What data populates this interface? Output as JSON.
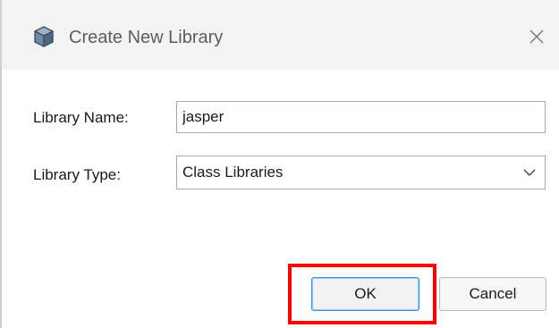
{
  "window": {
    "title": "Create New Library",
    "icon": "cube-icon",
    "close_icon": "close-icon"
  },
  "form": {
    "name_label": "Library Name:",
    "name_value": "jasper",
    "type_label": "Library Type:",
    "type_value": "Class Libraries",
    "type_icon": "chevron-down-icon"
  },
  "buttons": {
    "ok_label": "OK",
    "cancel_label": "Cancel"
  },
  "colors": {
    "highlight": "#ff0000",
    "ok_focus_border": "#3b8fd6"
  }
}
